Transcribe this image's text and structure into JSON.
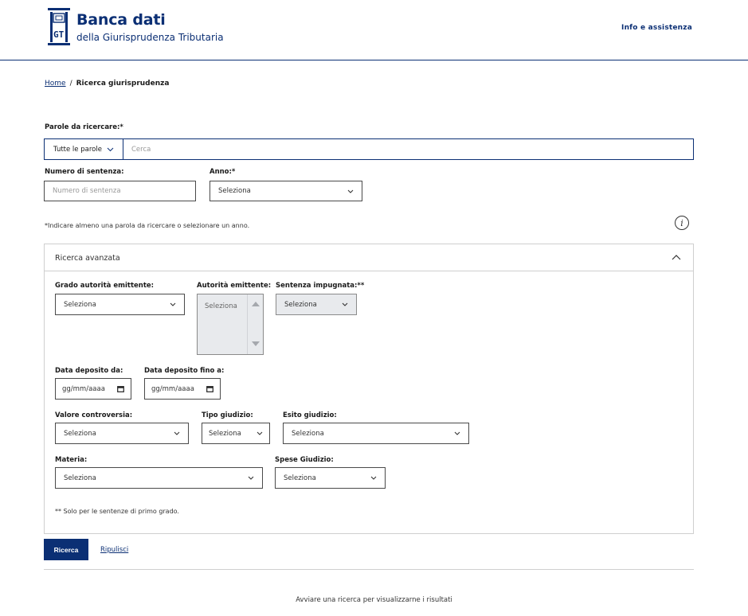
{
  "header": {
    "logo_text": "GT",
    "title": "Banca dati",
    "subtitle": "della Giurisprudenza Tributaria",
    "help_link": "Info e assistenza"
  },
  "breadcrumb": {
    "home": "Home",
    "separator": "/",
    "current": "Ricerca giurisprudenza"
  },
  "search": {
    "label": "Parole da ricercare:*",
    "mode": "Tutte le parole",
    "placeholder": "Cerca"
  },
  "numero": {
    "label": "Numero di sentenza:",
    "placeholder": "Numero di sentenza"
  },
  "anno": {
    "label": "Anno:*",
    "value": "Seleziona"
  },
  "required_note": "*Indicare almeno una parola da ricercare o selezionare un anno.",
  "advanced": {
    "title": "Ricerca avanzata",
    "grado": {
      "label": "Grado autorità emittente:",
      "value": "Seleziona"
    },
    "autorita": {
      "label": "Autorità emittente:",
      "value": "Seleziona"
    },
    "sentenza_impugnata": {
      "label": "Sentenza impugnata:**",
      "value": "Seleziona"
    },
    "data_da": {
      "label": "Data deposito da:",
      "value": "gg/mm/aaaa"
    },
    "data_a": {
      "label": "Data deposito fino a:",
      "value": "gg/mm/aaaa"
    },
    "valore": {
      "label": "Valore controversia:",
      "value": "Seleziona"
    },
    "tipo": {
      "label": "Tipo giudizio:",
      "value": "Seleziona"
    },
    "esito": {
      "label": "Esito giudizio:",
      "value": "Seleziona"
    },
    "materia": {
      "label": "Materia:",
      "value": "Seleziona"
    },
    "spese": {
      "label": "Spese Giudizio:",
      "value": "Seleziona"
    },
    "footnote": "** Solo per le sentenze di primo grado."
  },
  "actions": {
    "search": "Ricerca",
    "clear": "Ripulisci"
  },
  "results_message": "Avviare una ricerca per visualizzarne i risultati",
  "colors": {
    "primary": "#0b2f74",
    "border": "#cfcfcf",
    "disabled_bg": "#e8eaed"
  }
}
